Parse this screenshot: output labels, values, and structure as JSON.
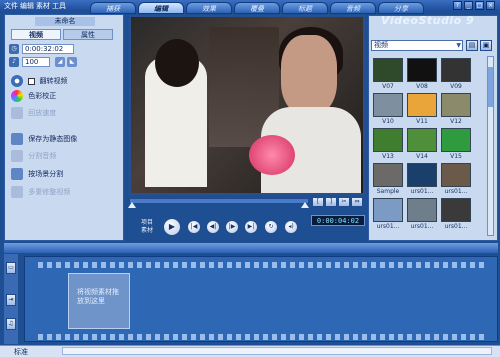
{
  "menu": [
    "文件",
    "编辑",
    "素材",
    "工具"
  ],
  "steps": [
    {
      "label": "捕获",
      "active": false
    },
    {
      "label": "编辑",
      "active": true
    },
    {
      "label": "效果",
      "active": false
    },
    {
      "label": "覆叠",
      "active": false
    },
    {
      "label": "标题",
      "active": false
    },
    {
      "label": "音频",
      "active": false
    },
    {
      "label": "分享",
      "active": false
    }
  ],
  "window_controls": [
    "?",
    "_",
    "□",
    "×"
  ],
  "options": {
    "clip_name": "未命名",
    "tabs": [
      {
        "label": "视频",
        "active": true
      },
      {
        "label": "属性",
        "active": false
      }
    ],
    "duration": "0:00:32:02",
    "volume": "100",
    "reverse_label": "翻转视频",
    "color_correct_label": "色彩校正",
    "playback_speed_label": "回放速度",
    "save_still_label": "保存为静态图像",
    "split_audio_label": "分割音频",
    "split_scene_label": "按场景分割",
    "multi_trim_label": "多重修整视频"
  },
  "preview": {
    "mode_labels": [
      "项目",
      "素材"
    ],
    "controls": [
      "play",
      "home",
      "prev",
      "next",
      "end",
      "repeat",
      "volume"
    ],
    "timecode": "0:00:04:02",
    "scrubber_fraction": 1.0,
    "scrub_buttons": [
      "[",
      "]",
      "✂",
      "⇔"
    ]
  },
  "library": {
    "logo": "VideoStudio 9",
    "selected": "视频",
    "thumbs": [
      {
        "label": "V07",
        "color": "#2f4a2a"
      },
      {
        "label": "V08",
        "color": "#111111"
      },
      {
        "label": "V09",
        "color": "#333333"
      },
      {
        "label": "V10",
        "color": "#7e8f9f"
      },
      {
        "label": "V11",
        "color": "#e9a43a"
      },
      {
        "label": "V12",
        "color": "#8b8a6a"
      },
      {
        "label": "V13",
        "color": "#3f7e2f"
      },
      {
        "label": "V14",
        "color": "#4f8f3a"
      },
      {
        "label": "V15",
        "color": "#2e9b3f"
      },
      {
        "label": "Sample",
        "color": "#6c6a68"
      },
      {
        "label": "urs01...",
        "color": "#1b3f6b"
      },
      {
        "label": "urs01...",
        "color": "#6b5a4a"
      },
      {
        "label": "urs01...",
        "color": "#7b9ac4"
      },
      {
        "label": "urs01...",
        "color": "#6e7e8a"
      },
      {
        "label": "urs01...",
        "color": "#3a3a3a"
      }
    ]
  },
  "timeline": {
    "drop_hint": "将视频素材拖放到这里",
    "status_label": "标准"
  }
}
